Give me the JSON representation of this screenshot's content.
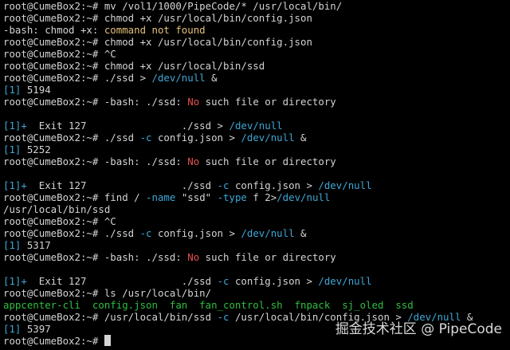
{
  "terminal": {
    "lines": [
      [
        {
          "t": "root@CumeBox2:~# mv /vol1/1000/PipeCode/* /usr/local/bin/",
          "c": "white"
        }
      ],
      [
        {
          "t": "root@CumeBox2:~# chmod +x /usr/local/bin/config.json",
          "c": "white"
        }
      ],
      [
        {
          "t": "-bash: chmod +x: ",
          "c": "white"
        },
        {
          "t": "command not found",
          "c": "yellow"
        }
      ],
      [
        {
          "t": "root@CumeBox2:~# chmod +x /usr/local/bin/config.json",
          "c": "white"
        }
      ],
      [
        {
          "t": "root@CumeBox2:~# ^C",
          "c": "white"
        }
      ],
      [
        {
          "t": "root@CumeBox2:~# chmod +x /usr/local/bin/ssd",
          "c": "white"
        }
      ],
      [
        {
          "t": "root@CumeBox2:~# ./ssd > ",
          "c": "white"
        },
        {
          "t": "/dev/null",
          "c": "cyan"
        },
        {
          "t": " &",
          "c": "white"
        }
      ],
      [
        {
          "t": "[1]",
          "c": "cyan"
        },
        {
          "t": " 5194",
          "c": "white"
        }
      ],
      [
        {
          "t": "root@CumeBox2:~# -bash: ./ssd: ",
          "c": "white"
        },
        {
          "t": "No",
          "c": "red"
        },
        {
          "t": " such file or directory",
          "c": "white"
        }
      ],
      [],
      [
        {
          "t": "[1]+",
          "c": "cyan"
        },
        {
          "t": "  Exit 127                ./ssd > ",
          "c": "white"
        },
        {
          "t": "/dev/null",
          "c": "cyan"
        }
      ],
      [
        {
          "t": "root@CumeBox2:~# ./ssd ",
          "c": "white"
        },
        {
          "t": "-c",
          "c": "cyan"
        },
        {
          "t": " config.json > ",
          "c": "white"
        },
        {
          "t": "/dev/null",
          "c": "cyan"
        },
        {
          "t": " &",
          "c": "white"
        }
      ],
      [
        {
          "t": "[1]",
          "c": "cyan"
        },
        {
          "t": " 5252",
          "c": "white"
        }
      ],
      [
        {
          "t": "root@CumeBox2:~# -bash: ./ssd: ",
          "c": "white"
        },
        {
          "t": "No",
          "c": "red"
        },
        {
          "t": " such file or directory",
          "c": "white"
        }
      ],
      [],
      [
        {
          "t": "[1]+",
          "c": "cyan"
        },
        {
          "t": "  Exit 127                ./ssd ",
          "c": "white"
        },
        {
          "t": "-c",
          "c": "cyan"
        },
        {
          "t": " config.json > ",
          "c": "white"
        },
        {
          "t": "/dev/null",
          "c": "cyan"
        }
      ],
      [
        {
          "t": "root@CumeBox2:~# find / ",
          "c": "white"
        },
        {
          "t": "-name",
          "c": "cyan"
        },
        {
          "t": " \"ssd\" ",
          "c": "white"
        },
        {
          "t": "-type",
          "c": "cyan"
        },
        {
          "t": " f 2>",
          "c": "white"
        },
        {
          "t": "/dev/null",
          "c": "cyan"
        }
      ],
      [
        {
          "t": "/usr/local/bin/ssd",
          "c": "white"
        }
      ],
      [
        {
          "t": "root@CumeBox2:~# ^C",
          "c": "white"
        }
      ],
      [
        {
          "t": "root@CumeBox2:~# ./ssd ",
          "c": "white"
        },
        {
          "t": "-c",
          "c": "cyan"
        },
        {
          "t": " config.json > ",
          "c": "white"
        },
        {
          "t": "/dev/null",
          "c": "cyan"
        },
        {
          "t": " &",
          "c": "white"
        }
      ],
      [
        {
          "t": "[1]",
          "c": "cyan"
        },
        {
          "t": " 5317",
          "c": "white"
        }
      ],
      [
        {
          "t": "root@CumeBox2:~# -bash: ./ssd: ",
          "c": "white"
        },
        {
          "t": "No",
          "c": "red"
        },
        {
          "t": " such file or directory",
          "c": "white"
        }
      ],
      [],
      [
        {
          "t": "[1]+",
          "c": "cyan"
        },
        {
          "t": "  Exit 127                ./ssd ",
          "c": "white"
        },
        {
          "t": "-c",
          "c": "cyan"
        },
        {
          "t": " config.json > ",
          "c": "white"
        },
        {
          "t": "/dev/null",
          "c": "cyan"
        }
      ],
      [
        {
          "t": "root@CumeBox2:~# ls /usr/local/bin/",
          "c": "white"
        }
      ],
      [
        {
          "t": "appcenter-cli  config.json  fan  fan_control.sh  fnpack  sj_oled  ssd",
          "c": "green"
        }
      ],
      [
        {
          "t": "root@CumeBox2:~# /usr/local/bin/ssd ",
          "c": "white"
        },
        {
          "t": "-c",
          "c": "cyan"
        },
        {
          "t": " /usr/local/bin/config.json > ",
          "c": "white"
        },
        {
          "t": "/dev/null",
          "c": "cyan"
        },
        {
          "t": " &",
          "c": "white"
        }
      ],
      [
        {
          "t": "[1]",
          "c": "cyan"
        },
        {
          "t": " 5397",
          "c": "white"
        }
      ],
      [
        {
          "t": "root@CumeBox2:~# ",
          "c": "white"
        }
      ]
    ],
    "colors": {
      "background": "#000000",
      "white": "#d4d4d4",
      "cyan": "#3fa7d6",
      "yellow": "#e5c07b",
      "red": "#e25050",
      "green": "#2fbf3f"
    }
  },
  "watermark": {
    "text": "掘金技术社区 @ PipeCode"
  }
}
